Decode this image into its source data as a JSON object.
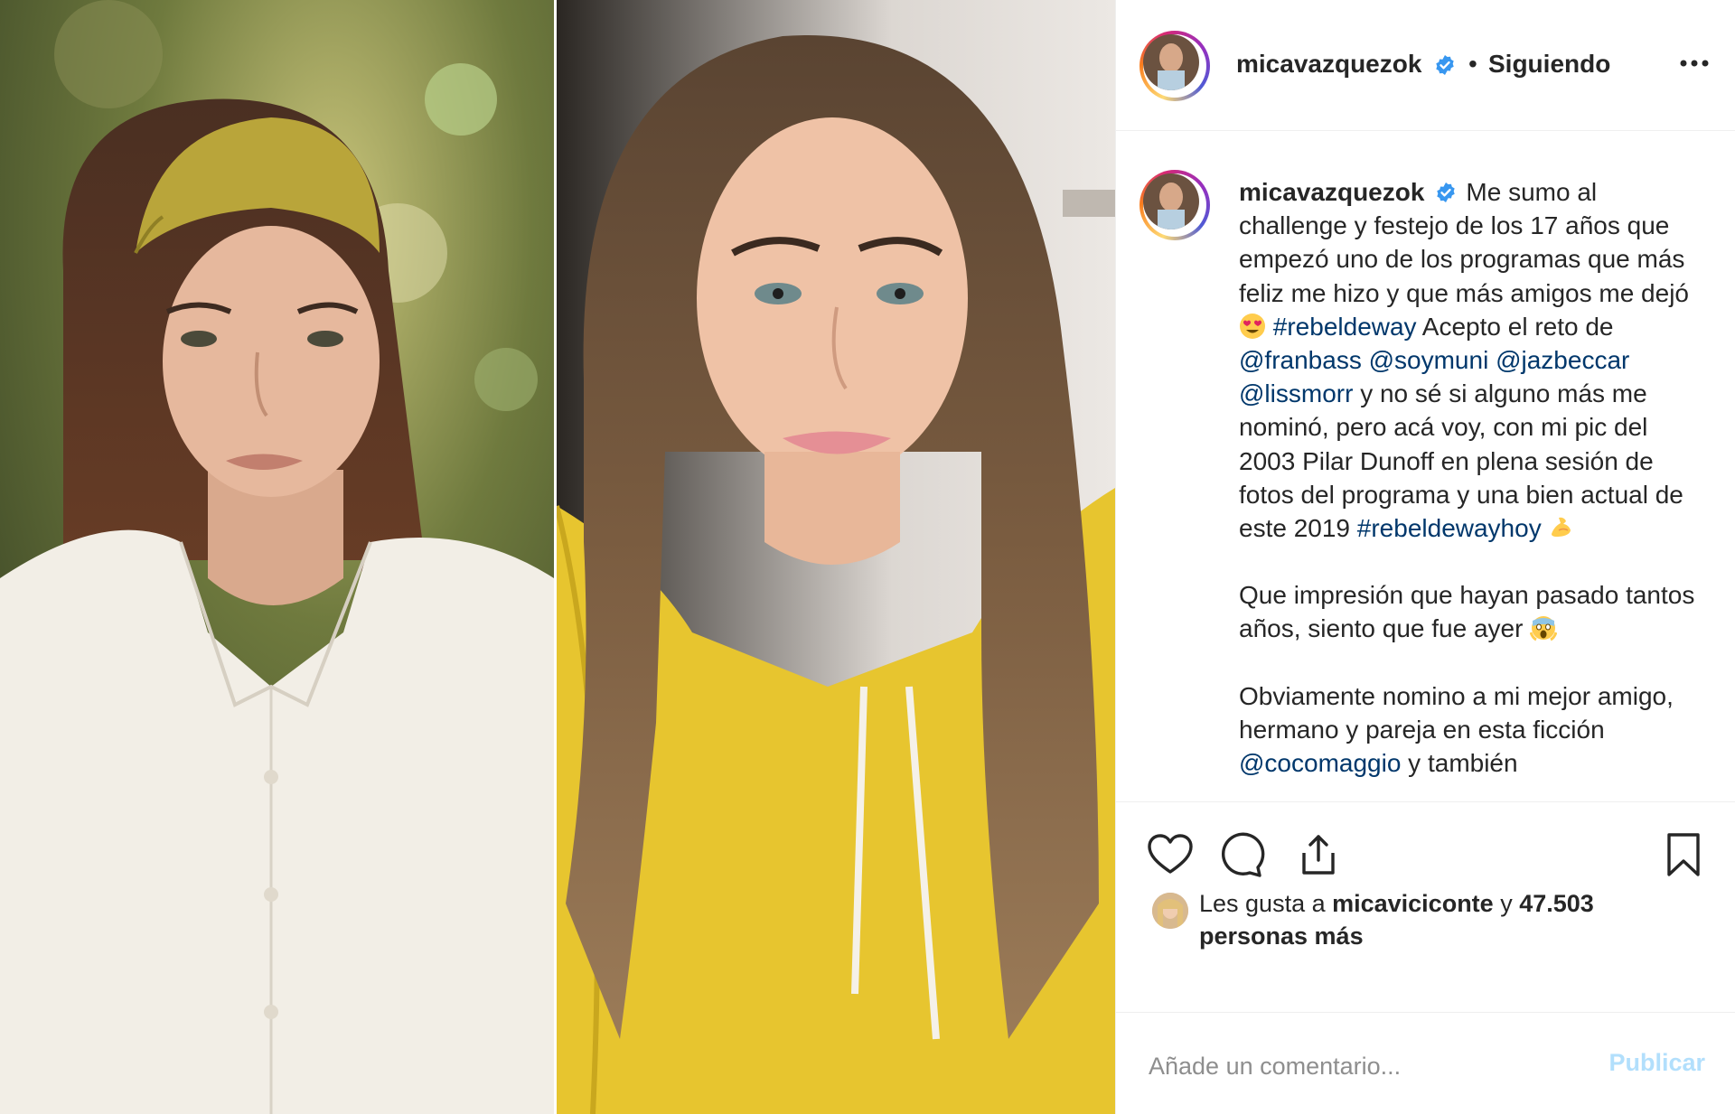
{
  "post": {
    "username": "micavazquezok",
    "follow_separator": "•",
    "follow_status": "Siguiendo",
    "images": [
      {
        "name": "young-portrait-photo"
      },
      {
        "name": "current-selfie-photo"
      }
    ]
  },
  "caption": {
    "username": "micavazquezok",
    "t1": "Me sumo al challenge y festejo de los 17 años que empezó uno de los programas que más feliz me hizo y que más amigos me dejó ",
    "emoji1": "heart-eyes-emoji",
    "tag1": "#rebeldeway",
    "t2": " Acepto el reto de ",
    "m1": "@franbass",
    "m2": "@soymuni",
    "m3": "@jazbeccar",
    "m4": "@lissmorr",
    "t3": " y no sé si alguno más me nominó, pero acá voy, con mi pic del 2003 Pilar Dunoff en plena sesión de fotos del programa y una bien actual de este 2019 ",
    "tag2": "#rebeldewayhoy",
    "emoji2": "flexed-biceps-emoji",
    "p2": "Que impresión que hayan pasado tantos años, siento que fue ayer ",
    "emoji3": "screaming-face-emoji",
    "p3a": "Obviamente nomino a mi mejor amigo, hermano y pareja en esta ficción ",
    "m5": "@cocomaggio",
    "p3b": " y también"
  },
  "likes": {
    "prefix": "Les gusta a ",
    "user": "micaviciconte",
    "mid": " y ",
    "count": "47.503 personas más"
  },
  "comment": {
    "placeholder": "Añade un comentario...",
    "publish": "Publicar"
  },
  "colors": {
    "link": "#00376b",
    "publish_disabled": "#b2dffc",
    "verified": "#3897f0"
  }
}
